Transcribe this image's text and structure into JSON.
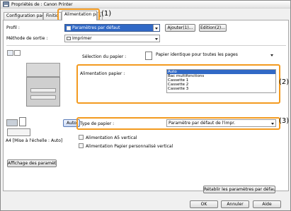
{
  "window": {
    "title": "Propriétés de : Canon Printer"
  },
  "tabs": [
    {
      "label": "Configuration page"
    },
    {
      "label": "Finitio"
    },
    {
      "label": "Alimentation papier"
    }
  ],
  "callouts": {
    "c1": "(1)",
    "c2": "(2)",
    "c3": "(3)"
  },
  "profile": {
    "label": "Profil :",
    "value": "Paramètres par défaut",
    "add_button": "Ajouter(1)...",
    "edit_button": "Edition(2)..."
  },
  "output_method": {
    "label": "Méthode de sortie :",
    "value": "Imprimer"
  },
  "paper_selection": {
    "label": "Sélection du papier :",
    "value": "Papier identique pour toutes les pages"
  },
  "paper_source": {
    "label": "Alimentation papier :",
    "items": [
      "Auto",
      "Bac multifonctions",
      "Cassette 1",
      "Cassette 2",
      "Cassette 3"
    ],
    "selected_index": 0
  },
  "paper_type": {
    "label": "Type de papier :",
    "value": "Paramètre par défaut de l'impr."
  },
  "checkboxes": {
    "a5_vertical": "Alimentation A5 vertical",
    "custom_vertical": "Alimentation Papier personnalisé vertical"
  },
  "preview": {
    "auto_button": "Auto",
    "status": "A4 [Mise à l'échelle : Auto]"
  },
  "buttons": {
    "show_settings": "Affichage des paramètres",
    "restore_defaults": "Rétablir les paramètres par défaut",
    "ok": "OK",
    "cancel": "Annuler",
    "help": "Aide"
  },
  "colors": {
    "highlight": "#f39a1f",
    "selection": "#3169c6"
  }
}
